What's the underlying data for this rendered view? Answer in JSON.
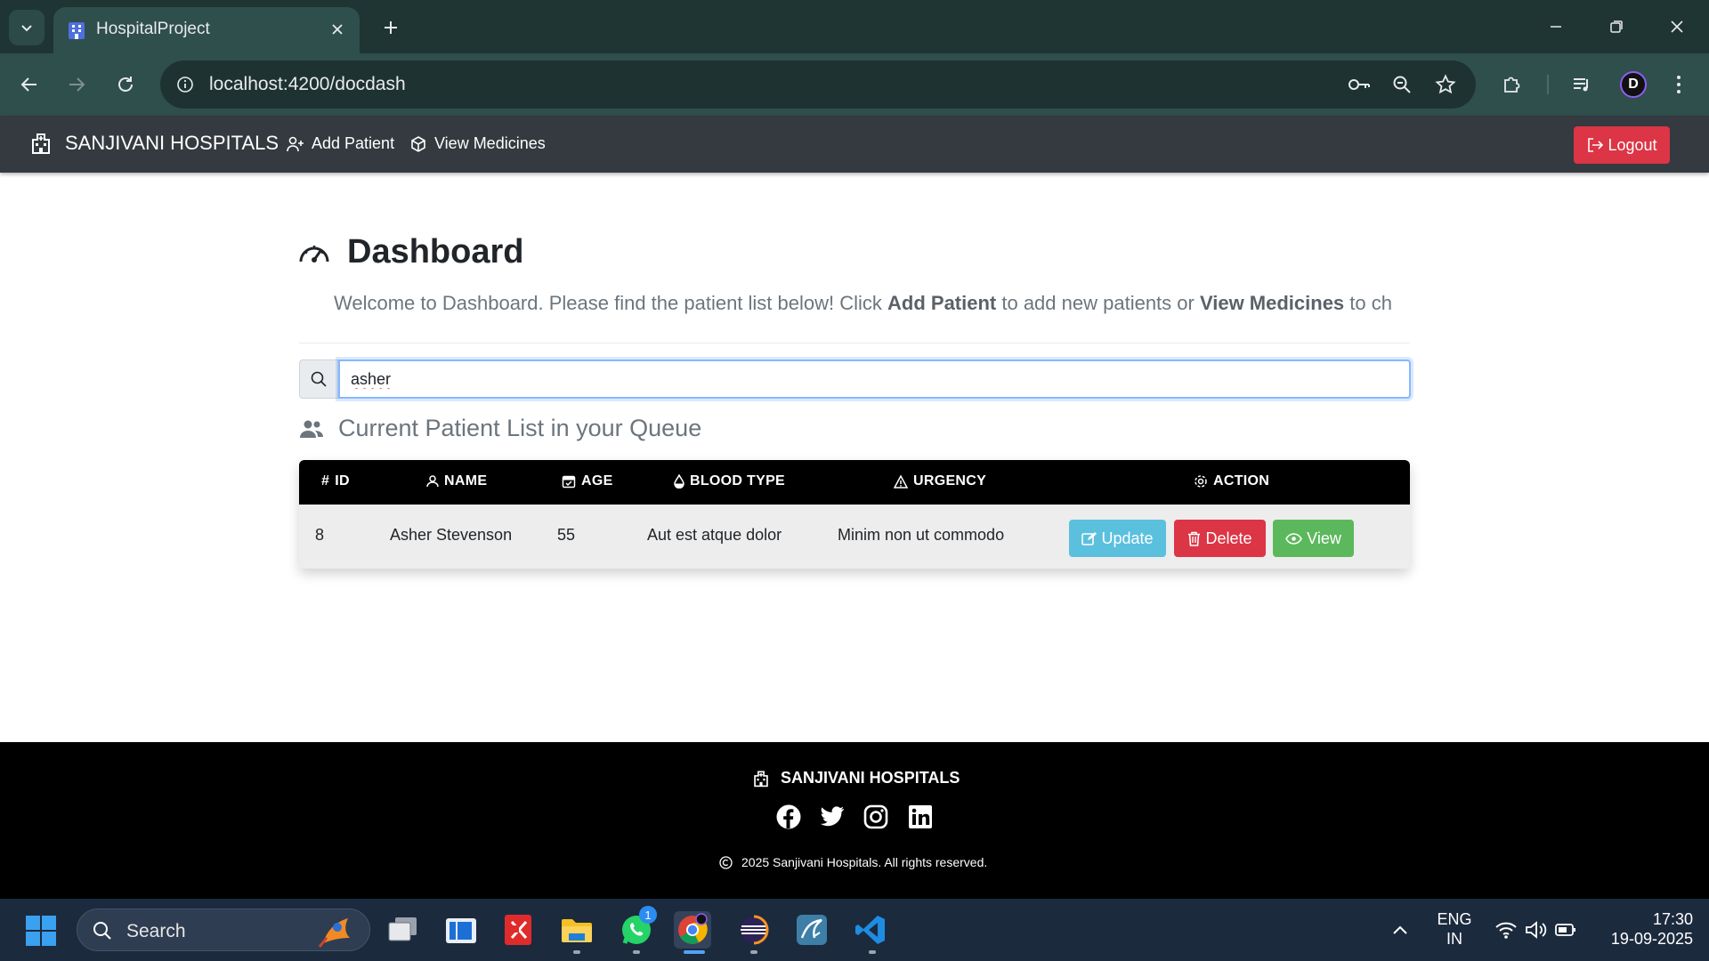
{
  "browser": {
    "tab_title": "HospitalProject",
    "url": "localhost:4200/docdash",
    "profile_initial": "D"
  },
  "navbar": {
    "brand": "SANJIVANI HOSPITALS",
    "links": [
      {
        "label": "Add Patient",
        "icon": "user-plus-icon"
      },
      {
        "label": "View Medicines",
        "icon": "box-icon"
      }
    ],
    "logout_label": "Logout"
  },
  "dashboard": {
    "title": "Dashboard",
    "welcome_prefix": "Welcome to Dashboard. Please find the patient list below! Click ",
    "welcome_bold1": "Add Patient",
    "welcome_mid": " to add new patients or ",
    "welcome_bold2": "View Medicines",
    "welcome_suffix": " to ch"
  },
  "search": {
    "value": "asher"
  },
  "patients": {
    "title": "Current Patient List in your Queue",
    "columns": [
      "ID",
      "NAME",
      "AGE",
      "BLOOD TYPE",
      "URGENCY",
      "ACTION"
    ],
    "rows": [
      {
        "id": "8",
        "name": "Asher Stevenson",
        "age": "55",
        "blood_type": "Aut est atque dolor",
        "urgency": "Minim non ut commodo"
      }
    ],
    "actions": {
      "update": "Update",
      "delete": "Delete",
      "view": "View"
    },
    "colors": {
      "update": "#5bc0de",
      "delete": "#dc3545",
      "view": "#5cb85c",
      "header": "#000000"
    }
  },
  "footer": {
    "brand": "SANJIVANI HOSPITALS",
    "social": [
      "facebook-icon",
      "twitter-icon",
      "instagram-icon",
      "linkedin-icon"
    ],
    "copyright": "2025 Sanjivani Hospitals. All rights reserved."
  },
  "taskbar": {
    "search_label": "Search",
    "whatsapp_badge": "1",
    "language_line1": "ENG",
    "language_line2": "IN",
    "time": "17:30",
    "date": "19-09-2025"
  }
}
